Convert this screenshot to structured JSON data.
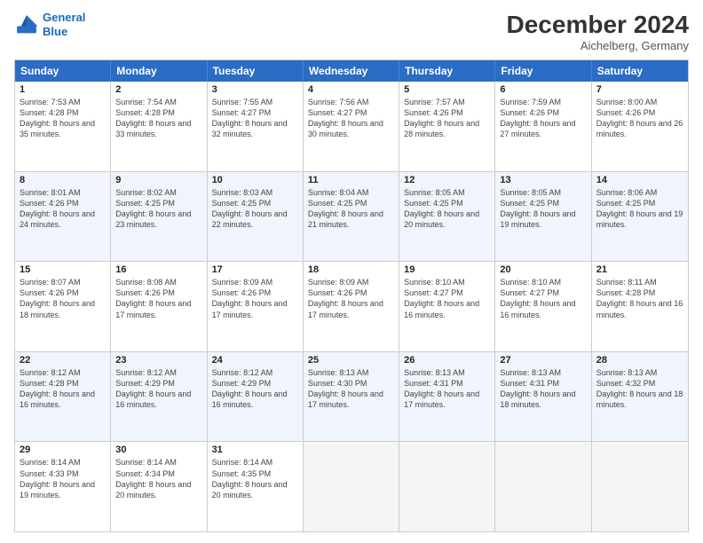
{
  "header": {
    "logo_line1": "General",
    "logo_line2": "Blue",
    "month": "December 2024",
    "location": "Aichelberg, Germany"
  },
  "weekdays": [
    "Sunday",
    "Monday",
    "Tuesday",
    "Wednesday",
    "Thursday",
    "Friday",
    "Saturday"
  ],
  "rows": [
    [
      {
        "day": "1",
        "rise": "7:53 AM",
        "set": "4:28 PM",
        "daylight": "8 hours and 35 minutes."
      },
      {
        "day": "2",
        "rise": "7:54 AM",
        "set": "4:28 PM",
        "daylight": "8 hours and 33 minutes."
      },
      {
        "day": "3",
        "rise": "7:55 AM",
        "set": "4:27 PM",
        "daylight": "8 hours and 32 minutes."
      },
      {
        "day": "4",
        "rise": "7:56 AM",
        "set": "4:27 PM",
        "daylight": "8 hours and 30 minutes."
      },
      {
        "day": "5",
        "rise": "7:57 AM",
        "set": "4:26 PM",
        "daylight": "8 hours and 28 minutes."
      },
      {
        "day": "6",
        "rise": "7:59 AM",
        "set": "4:26 PM",
        "daylight": "8 hours and 27 minutes."
      },
      {
        "day": "7",
        "rise": "8:00 AM",
        "set": "4:26 PM",
        "daylight": "8 hours and 26 minutes."
      }
    ],
    [
      {
        "day": "8",
        "rise": "8:01 AM",
        "set": "4:26 PM",
        "daylight": "8 hours and 24 minutes."
      },
      {
        "day": "9",
        "rise": "8:02 AM",
        "set": "4:25 PM",
        "daylight": "8 hours and 23 minutes."
      },
      {
        "day": "10",
        "rise": "8:03 AM",
        "set": "4:25 PM",
        "daylight": "8 hours and 22 minutes."
      },
      {
        "day": "11",
        "rise": "8:04 AM",
        "set": "4:25 PM",
        "daylight": "8 hours and 21 minutes."
      },
      {
        "day": "12",
        "rise": "8:05 AM",
        "set": "4:25 PM",
        "daylight": "8 hours and 20 minutes."
      },
      {
        "day": "13",
        "rise": "8:05 AM",
        "set": "4:25 PM",
        "daylight": "8 hours and 19 minutes."
      },
      {
        "day": "14",
        "rise": "8:06 AM",
        "set": "4:25 PM",
        "daylight": "8 hours and 19 minutes."
      }
    ],
    [
      {
        "day": "15",
        "rise": "8:07 AM",
        "set": "4:26 PM",
        "daylight": "8 hours and 18 minutes."
      },
      {
        "day": "16",
        "rise": "8:08 AM",
        "set": "4:26 PM",
        "daylight": "8 hours and 17 minutes."
      },
      {
        "day": "17",
        "rise": "8:09 AM",
        "set": "4:26 PM",
        "daylight": "8 hours and 17 minutes."
      },
      {
        "day": "18",
        "rise": "8:09 AM",
        "set": "4:26 PM",
        "daylight": "8 hours and 17 minutes."
      },
      {
        "day": "19",
        "rise": "8:10 AM",
        "set": "4:27 PM",
        "daylight": "8 hours and 16 minutes."
      },
      {
        "day": "20",
        "rise": "8:10 AM",
        "set": "4:27 PM",
        "daylight": "8 hours and 16 minutes."
      },
      {
        "day": "21",
        "rise": "8:11 AM",
        "set": "4:28 PM",
        "daylight": "8 hours and 16 minutes."
      }
    ],
    [
      {
        "day": "22",
        "rise": "8:12 AM",
        "set": "4:28 PM",
        "daylight": "8 hours and 16 minutes."
      },
      {
        "day": "23",
        "rise": "8:12 AM",
        "set": "4:29 PM",
        "daylight": "8 hours and 16 minutes."
      },
      {
        "day": "24",
        "rise": "8:12 AM",
        "set": "4:29 PM",
        "daylight": "8 hours and 16 minutes."
      },
      {
        "day": "25",
        "rise": "8:13 AM",
        "set": "4:30 PM",
        "daylight": "8 hours and 17 minutes."
      },
      {
        "day": "26",
        "rise": "8:13 AM",
        "set": "4:31 PM",
        "daylight": "8 hours and 17 minutes."
      },
      {
        "day": "27",
        "rise": "8:13 AM",
        "set": "4:31 PM",
        "daylight": "8 hours and 18 minutes."
      },
      {
        "day": "28",
        "rise": "8:13 AM",
        "set": "4:32 PM",
        "daylight": "8 hours and 18 minutes."
      }
    ],
    [
      {
        "day": "29",
        "rise": "8:14 AM",
        "set": "4:33 PM",
        "daylight": "8 hours and 19 minutes."
      },
      {
        "day": "30",
        "rise": "8:14 AM",
        "set": "4:34 PM",
        "daylight": "8 hours and 20 minutes."
      },
      {
        "day": "31",
        "rise": "8:14 AM",
        "set": "4:35 PM",
        "daylight": "8 hours and 20 minutes."
      },
      null,
      null,
      null,
      null
    ]
  ]
}
